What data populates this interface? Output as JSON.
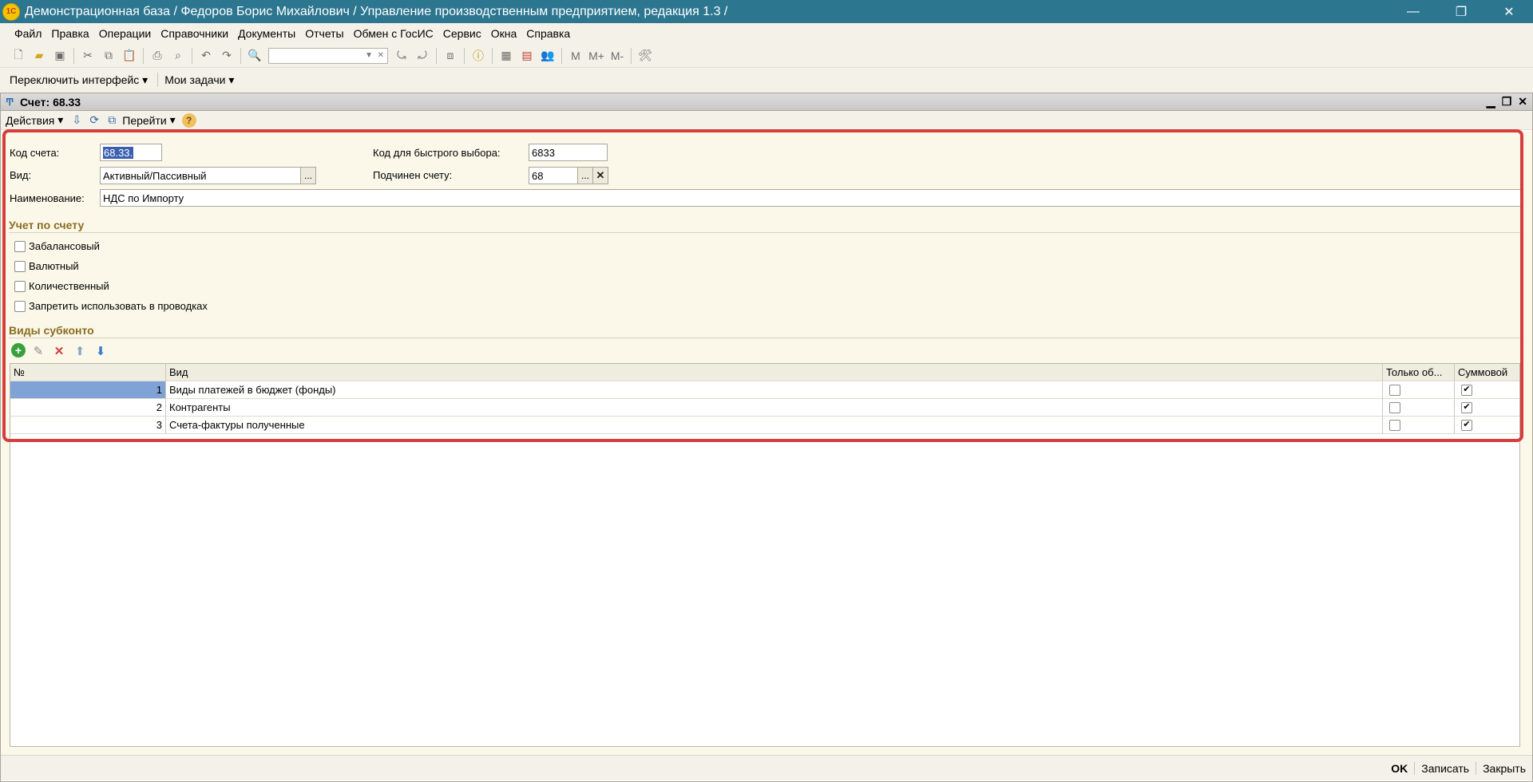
{
  "window": {
    "title": "Демонстрационная база / Федоров Борис Михайлович /  Управление производственным предприятием, редакция 1.3 /",
    "logo": "1С",
    "minimize": "—",
    "restore": "❐",
    "close": "✕"
  },
  "menu": {
    "items": [
      "Файл",
      "Правка",
      "Операции",
      "Справочники",
      "Документы",
      "Отчеты",
      "Обмен с ГосИС",
      "Сервис",
      "Окна",
      "Справка"
    ]
  },
  "interface_bar": {
    "switch_label": "Переключить интерфейс",
    "tasks_label": "Мои задачи"
  },
  "document": {
    "title": "Счет: 68.33",
    "toolbar": {
      "actions_label": "Действия",
      "goto_label": "Перейти",
      "help": "?"
    },
    "form": {
      "code_label": "Код счета:",
      "code_value": "68.33.",
      "quick_code_label": "Код для быстрого выбора:",
      "quick_code_value": "6833",
      "kind_label": "Вид:",
      "kind_value": "Активный/Пассивный",
      "parent_label": "Подчинен счету:",
      "parent_value": "68",
      "name_label": "Наименование:",
      "name_value": "НДС по Импорту",
      "dots": "...",
      "clear": "✕"
    },
    "accounting_section": {
      "title": "Учет по счету",
      "checkboxes": [
        {
          "label": "Забалансовый",
          "checked": false
        },
        {
          "label": "Валютный",
          "checked": false
        },
        {
          "label": "Количественный",
          "checked": false
        },
        {
          "label": "Запретить использовать в проводках",
          "checked": false
        }
      ]
    },
    "subconto_section": {
      "title": "Виды субконто",
      "columns": [
        "№",
        "Вид",
        "Только об...",
        "Суммовой"
      ],
      "rows": [
        {
          "num": "1",
          "kind": "Виды платежей в бюджет (фонды)",
          "turnover_only": false,
          "sum": true
        },
        {
          "num": "2",
          "kind": "Контрагенты",
          "turnover_only": false,
          "sum": true
        },
        {
          "num": "3",
          "kind": "Счета-фактуры полученные",
          "turnover_only": false,
          "sum": true
        }
      ]
    },
    "footer": {
      "ok": "OK",
      "save": "Записать",
      "close": "Закрыть"
    }
  },
  "colors": {
    "titlebar": "#2d7690",
    "highlight": "#d63d3d",
    "section_title": "#8a6d1f"
  }
}
